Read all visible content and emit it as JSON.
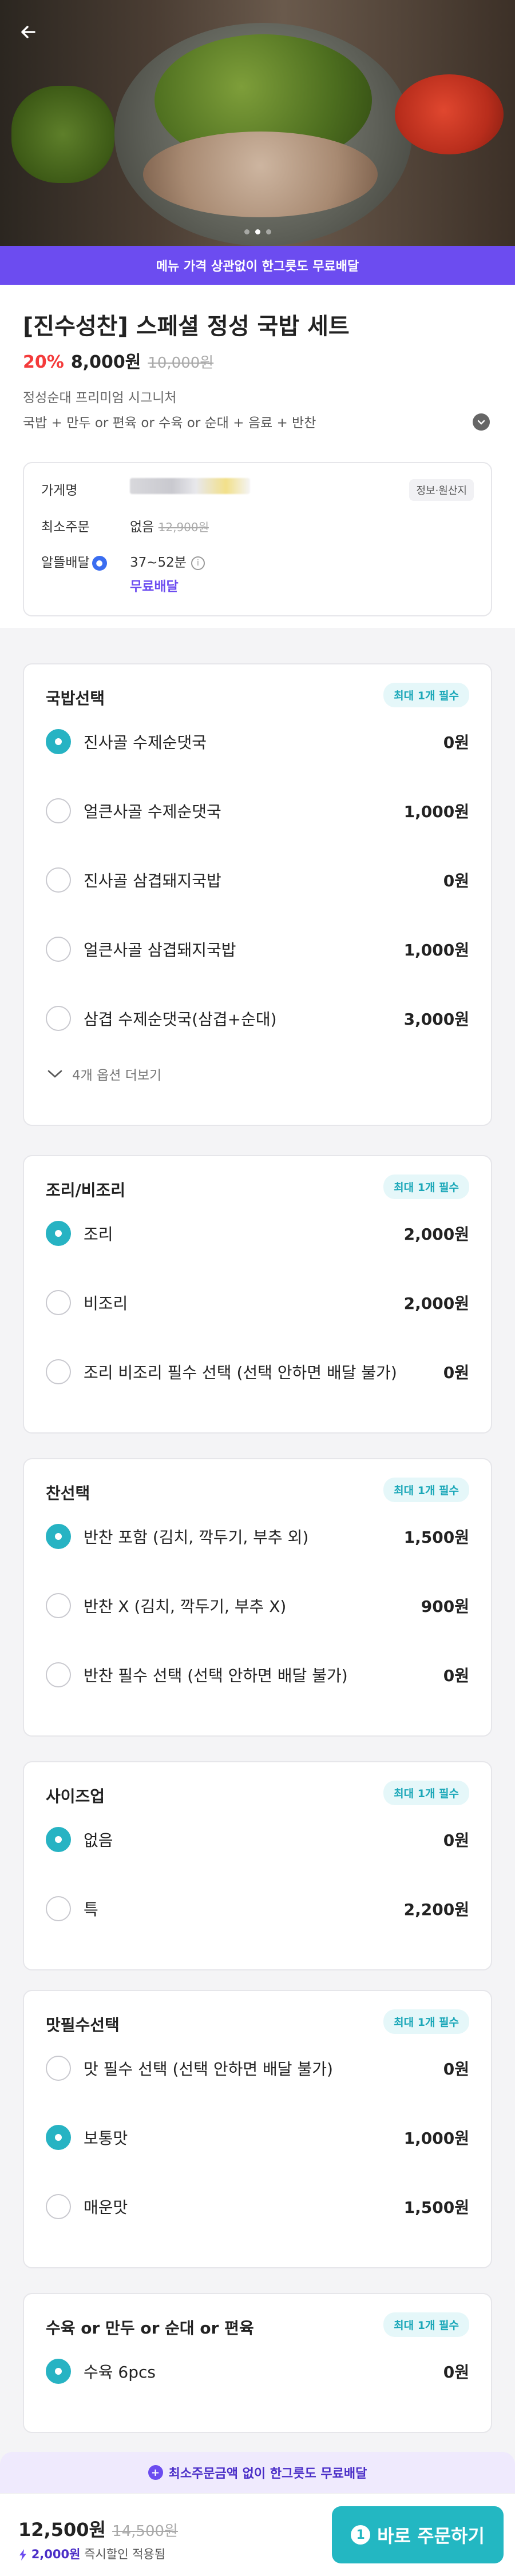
{
  "hero": {
    "image_label": "국밥 세트 사진",
    "page_dots": 3,
    "active_dot": 1
  },
  "banner": {
    "text": "메뉴 가격 상관없이 한그릇도 무료배달"
  },
  "product": {
    "title": "[진수성찬] 스페셜 정성 국밥 세트",
    "discount": "20%",
    "price": "8,000원",
    "original_price": "10,000원",
    "description": "정성순대 프리미엄 시그니처",
    "components": "국밥 + 만두 or 편육 or 수육 or 순대 + 음료 + 반찬"
  },
  "store": {
    "store_label": "가게명",
    "info_button": "정보·원산지",
    "min_order_label": "최소주문",
    "min_order_value": "없음",
    "min_order_strike": "12,900원",
    "delivery_label": "알뜰배달",
    "delivery_time": "37~52분",
    "free_delivery": "무료배달"
  },
  "groups": [
    {
      "title": "국밥선택",
      "badge": "최대 1개 필수",
      "options": [
        {
          "name": "진사골 수제순댓국",
          "price": "0원",
          "selected": true
        },
        {
          "name": "얼큰사골 수제순댓국",
          "price": "1,000원",
          "selected": false
        },
        {
          "name": "진사골 삼겹돼지국밥",
          "price": "0원",
          "selected": false
        },
        {
          "name": "얼큰사골 삼겹돼지국밥",
          "price": "1,000원",
          "selected": false
        },
        {
          "name": "삼겹 수제순댓국(삼겹+순대)",
          "price": "3,000원",
          "selected": false
        }
      ],
      "more": "4개 옵션 더보기"
    },
    {
      "title": "조리/비조리",
      "badge": "최대 1개 필수",
      "options": [
        {
          "name": "조리",
          "price": "2,000원",
          "selected": true
        },
        {
          "name": "비조리",
          "price": "2,000원",
          "selected": false
        },
        {
          "name": "조리 비조리 필수 선택 (선택 안하면 배달 불가)",
          "price": "0원",
          "selected": false
        }
      ]
    },
    {
      "title": "찬선택",
      "badge": "최대 1개 필수",
      "options": [
        {
          "name": "반찬 포함 (김치, 깍두기, 부추 외)",
          "price": "1,500원",
          "selected": true
        },
        {
          "name": "반찬 X (김치, 깍두기, 부추 X)",
          "price": "900원",
          "selected": false
        },
        {
          "name": "반찬 필수 선택 (선택 안하면 배달 불가)",
          "price": "0원",
          "selected": false
        }
      ]
    },
    {
      "title": "사이즈업",
      "badge": "최대 1개 필수",
      "options": [
        {
          "name": "없음",
          "price": "0원",
          "selected": true
        },
        {
          "name": "특",
          "price": "2,200원",
          "selected": false
        }
      ]
    },
    {
      "title": "맛필수선택",
      "badge": "최대 1개 필수",
      "options": [
        {
          "name": "맛 필수 선택 (선택 안하면 배달 불가)",
          "price": "0원",
          "selected": false
        },
        {
          "name": "보통맛",
          "price": "1,000원",
          "selected": true
        },
        {
          "name": "매운맛",
          "price": "1,500원",
          "selected": false
        }
      ]
    },
    {
      "title": "수육 or 만두 or 순대 or 편육",
      "badge": "최대 1개 필수",
      "options": [
        {
          "name": "수육 6pcs",
          "price": "0원",
          "selected": true
        }
      ]
    }
  ],
  "promo": {
    "text": "최소주문금액 없이 한그릇도 무료배달"
  },
  "bottom": {
    "total": "12,500원",
    "total_original": "14,500원",
    "instant_amount": "2,000원",
    "instant_text": "즉시할인 적용됨",
    "cart_count": "1",
    "order_label": "바로 주문하기"
  },
  "colors": {
    "accent_purple": "#6c4cf0",
    "accent_teal": "#27b3c3",
    "discount_red": "#f43b3b"
  }
}
